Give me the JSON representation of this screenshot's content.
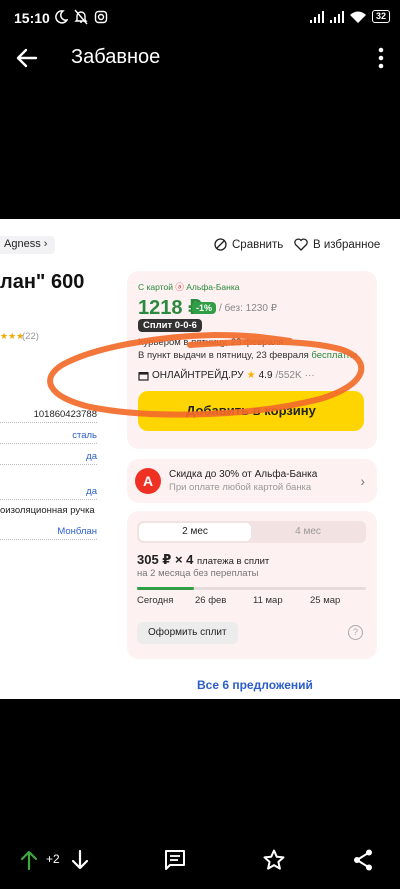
{
  "status_bar": {
    "time": "15:10",
    "battery": "32",
    "icons": [
      "moon-icon",
      "muted-bell-icon",
      "instagram-icon",
      "signal-icon",
      "signal-icon",
      "wifi-icon",
      "battery-icon"
    ]
  },
  "app_bar": {
    "title": "Забавное",
    "back_icon": "arrow-left-icon",
    "menu_icon": "kebab-menu-icon"
  },
  "product": {
    "brand_chip": "Agness",
    "compare_label": "Сравнить",
    "favorite_label": "В избранное",
    "title_fragment": "лан\" 600",
    "rating_count": "(22)",
    "specs": [
      {
        "value": "101860423788"
      },
      {
        "value": "сталь"
      },
      {
        "value": "да"
      },
      {
        "value": "да"
      },
      {
        "value": "оизоляционная ручка"
      },
      {
        "value": "Монблан"
      }
    ]
  },
  "price_card": {
    "card_label_prefix": "С картой",
    "card_label_bank": "Альфа-Банка",
    "price": "1218 ₽",
    "discount": "-1%",
    "price_without": "/ без: 1230 ₽",
    "split_badge": "Сплит 0-0-6",
    "delivery_courier": "Курьером в пятницу, 23 февраля",
    "delivery_pickup": "В пункт выдачи в пятницу, 23 февраля",
    "delivery_free": "бесплатно",
    "seller_name": "ОНЛАЙНТРЕЙД.РУ",
    "seller_rating": "4.9",
    "seller_reviews": "/552K",
    "seller_more": "···",
    "add_to_cart": "Добавить в корзину"
  },
  "alfa_promo": {
    "logo_letter": "А",
    "title": "Скидка до 30% от Альфа-Банка",
    "subtitle": "При оплате любой картой банка"
  },
  "split_card": {
    "period_active": "2 мес",
    "period_inactive": "4 мес",
    "amount": "305 ₽ × 4",
    "amount_suffix": "платежа в сплит",
    "subtitle": "на 2 месяца без переплаты",
    "dates": [
      "Сегодня",
      "26 фев",
      "11 мар",
      "25 мар"
    ],
    "progress_fraction": 0.25,
    "button": "Оформить сплит",
    "help": "?"
  },
  "all_offers": "Все 6 предложений",
  "bottom_bar": {
    "upvote_count": "+2",
    "icons": [
      "arrow-up-icon",
      "arrow-down-icon",
      "comment-icon",
      "star-icon",
      "share-icon"
    ]
  },
  "colors": {
    "accent_green": "#2b8a3e",
    "cart_yellow": "#fed500",
    "alfa_red": "#ef3124",
    "scribble_orange": "#f26b2a",
    "link_blue": "#2a5fc9"
  }
}
